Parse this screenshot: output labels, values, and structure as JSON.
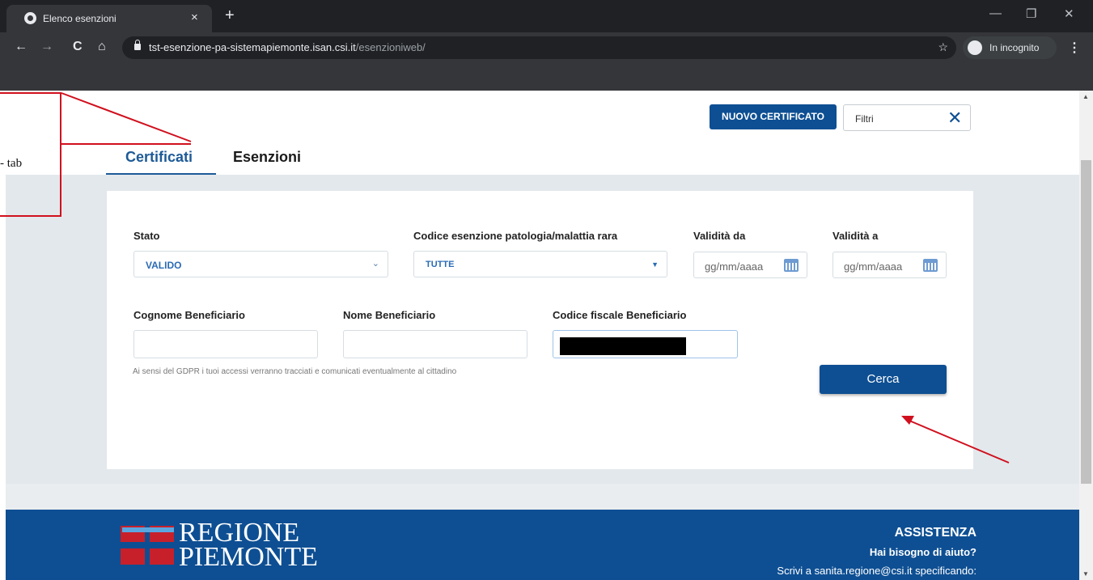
{
  "browser": {
    "tab_title": "Elenco esenzioni",
    "tab_close": "×",
    "new_tab": "+",
    "url_host": "tst-esenzione-pa-sistemapiemonte.isan.csi.it",
    "url_path": "/esenzioniweb/",
    "incognito_label": "In incognito",
    "win_minimize": "—",
    "win_restore": "❐",
    "win_close": "✕",
    "back": "←",
    "forward": "→",
    "reload": "C",
    "home": "⌂",
    "star": "☆",
    "menu": "⋮"
  },
  "header": {
    "new_certificate_label": "NUOVO CERTIFICATO",
    "filters_label": "Filtri",
    "filters_close": "✕"
  },
  "tabs": [
    {
      "label": "Certificati",
      "active": true
    },
    {
      "label": "Esenzioni",
      "active": false
    }
  ],
  "form": {
    "stato_label": "Stato",
    "stato_value": "VALIDO",
    "codice_label": "Codice esenzione patologia/malattia rara",
    "codice_value": "TUTTE",
    "validita_da_label": "Validità da",
    "validita_da_placeholder": "gg/mm/aaaa",
    "validita_a_label": "Validità a",
    "validita_a_placeholder": "gg/mm/aaaa",
    "cognome_label": "Cognome Beneficiario",
    "nome_label": "Nome Beneficiario",
    "cf_label": "Codice fiscale Beneficiario",
    "gdpr_note": "Ai sensi del GDPR i tuoi accessi verranno tracciati e comunicati eventualmente al cittadino",
    "search_label": "Cerca"
  },
  "footer": {
    "logo_line1": "REGIONE",
    "logo_line2": "PIEMONTE",
    "assist_title": "ASSISTENZA",
    "help_text": "Hai bisogno di aiuto?",
    "write_text": "Scrivi a sanita.regione@csi.it specificando:"
  },
  "annotation": {
    "callout_text": "- tab"
  },
  "colors": {
    "primary": "#0e4f93",
    "tab_active": "#1d5a97",
    "annotation_red": "#d0101e",
    "logo_red": "#c7202b"
  }
}
